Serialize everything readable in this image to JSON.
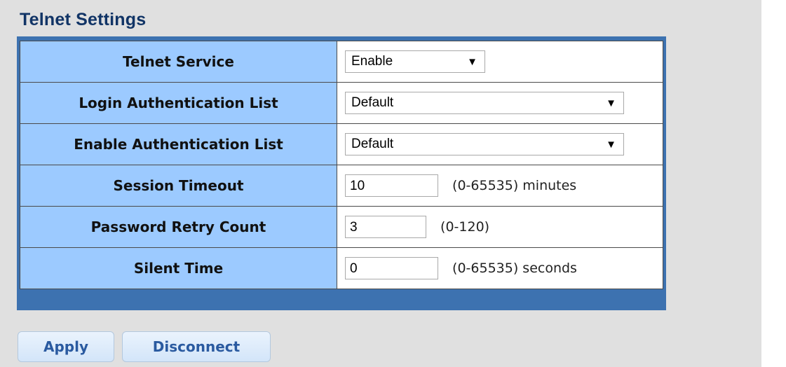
{
  "title": "Telnet Settings",
  "rows": [
    {
      "label": "Telnet Service",
      "select_value": "Enable"
    },
    {
      "label": "Login Authentication List",
      "select_value": "Default"
    },
    {
      "label": "Enable Authentication List",
      "select_value": "Default"
    },
    {
      "label": "Session Timeout",
      "input_value": "10",
      "hint": "(0-65535) minutes"
    },
    {
      "label": "Password Retry Count",
      "input_value": "3",
      "hint": "(0-120)"
    },
    {
      "label": "Silent Time",
      "input_value": "0",
      "hint": "(0-65535) seconds"
    }
  ],
  "buttons": {
    "apply": "Apply",
    "disconnect": "Disconnect"
  },
  "icons": {
    "dropdown": "chevron-down-icon"
  },
  "colors": {
    "title": "#113466",
    "panel_border": "#3d72b0",
    "label_bg": "#9ccaff",
    "button_text": "#2a5aa0",
    "page_bg": "#e0e0e0"
  }
}
